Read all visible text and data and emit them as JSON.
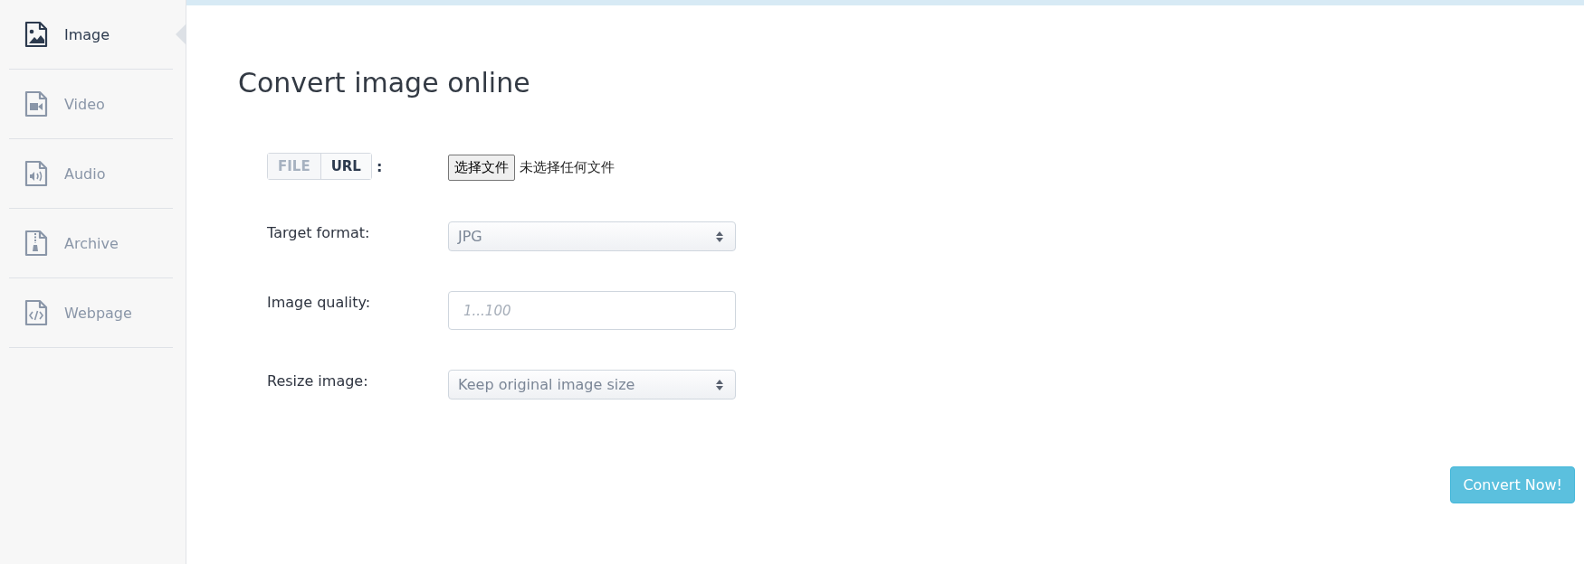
{
  "sidebar": {
    "items": [
      {
        "label": "Image",
        "kind": "image",
        "selected": true
      },
      {
        "label": "Video",
        "kind": "video",
        "selected": false
      },
      {
        "label": "Audio",
        "kind": "audio",
        "selected": false
      },
      {
        "label": "Archive",
        "kind": "archive",
        "selected": false
      },
      {
        "label": "Webpage",
        "kind": "webpage",
        "selected": false
      }
    ]
  },
  "title": "Convert image online",
  "form": {
    "source_tabs": [
      {
        "label": "FILE",
        "selected": false
      },
      {
        "label": "URL",
        "selected": true
      }
    ],
    "source_colon": ":",
    "file_button": "选择文件",
    "file_status": "未选择任何文件",
    "fields": [
      {
        "label": "Target format:",
        "kind": "select",
        "value": "JPG"
      },
      {
        "label": "Image quality:",
        "kind": "input",
        "placeholder": "1...100"
      },
      {
        "label": "Resize image:",
        "kind": "select",
        "value": "Keep original image size"
      }
    ]
  },
  "convert_button": "Convert Now!"
}
